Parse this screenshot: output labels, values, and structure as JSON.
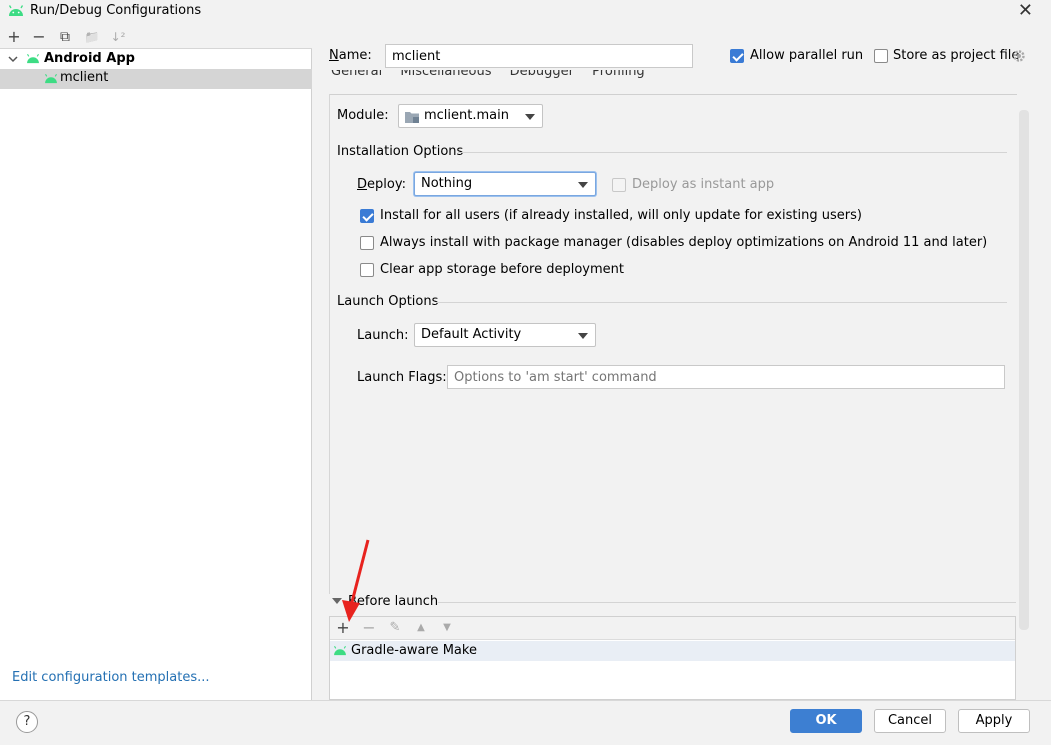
{
  "window": {
    "title": "Run/Debug Configurations",
    "close_glyph": "✕"
  },
  "left": {
    "toolbar": {
      "add": "+",
      "remove": "−",
      "copy": "⧉",
      "new_folder": "📁",
      "sort": "↓²"
    },
    "tree": {
      "group_label": "Android App",
      "item_label": "mclient"
    },
    "edit_templates": "Edit configuration templates..."
  },
  "header": {
    "name_label_pre": "N",
    "name_label_post": "ame:",
    "name_value": "mclient",
    "allow_parallel_label": "Allow parallel run",
    "allow_parallel_checked": true,
    "store_project_label": "Store as project file",
    "store_project_checked": false
  },
  "tabs": [
    "General",
    "Miscellaneous",
    "Debugger",
    "Profiling"
  ],
  "module": {
    "label": "Module:",
    "value": "mclient.main"
  },
  "installation": {
    "section_title": "Installation Options",
    "deploy_label": "Deploy:",
    "deploy_value": "Nothing",
    "instant_app_label": "Deploy as instant app",
    "install_all_users_label": "Install for all users (if already installed, will only update for existing users)",
    "install_all_users_checked": true,
    "always_install_label": "Always install with package manager (disables deploy optimizations on Android 11 and later)",
    "always_install_checked": false,
    "clear_storage_label": "Clear app storage before deployment",
    "clear_storage_checked": false
  },
  "launch": {
    "section_title": "Launch Options",
    "launch_label": "Launch:",
    "launch_value": "Default Activity",
    "flags_label": "Launch Flags:",
    "flags_placeholder": "Options to 'am start' command"
  },
  "before_launch": {
    "title": "Before launch",
    "toolbar": {
      "add": "+",
      "remove": "−",
      "edit": "✎",
      "up": "▲",
      "down": "▼"
    },
    "tasks": [
      "Gradle-aware Make"
    ]
  },
  "buttons": {
    "help": "?",
    "ok": "OK",
    "cancel": "Cancel",
    "apply": "Apply"
  },
  "colors": {
    "android_green": "#3ddc84",
    "accent": "#3d7fd2",
    "annotation_arrow": "#e8231f"
  }
}
